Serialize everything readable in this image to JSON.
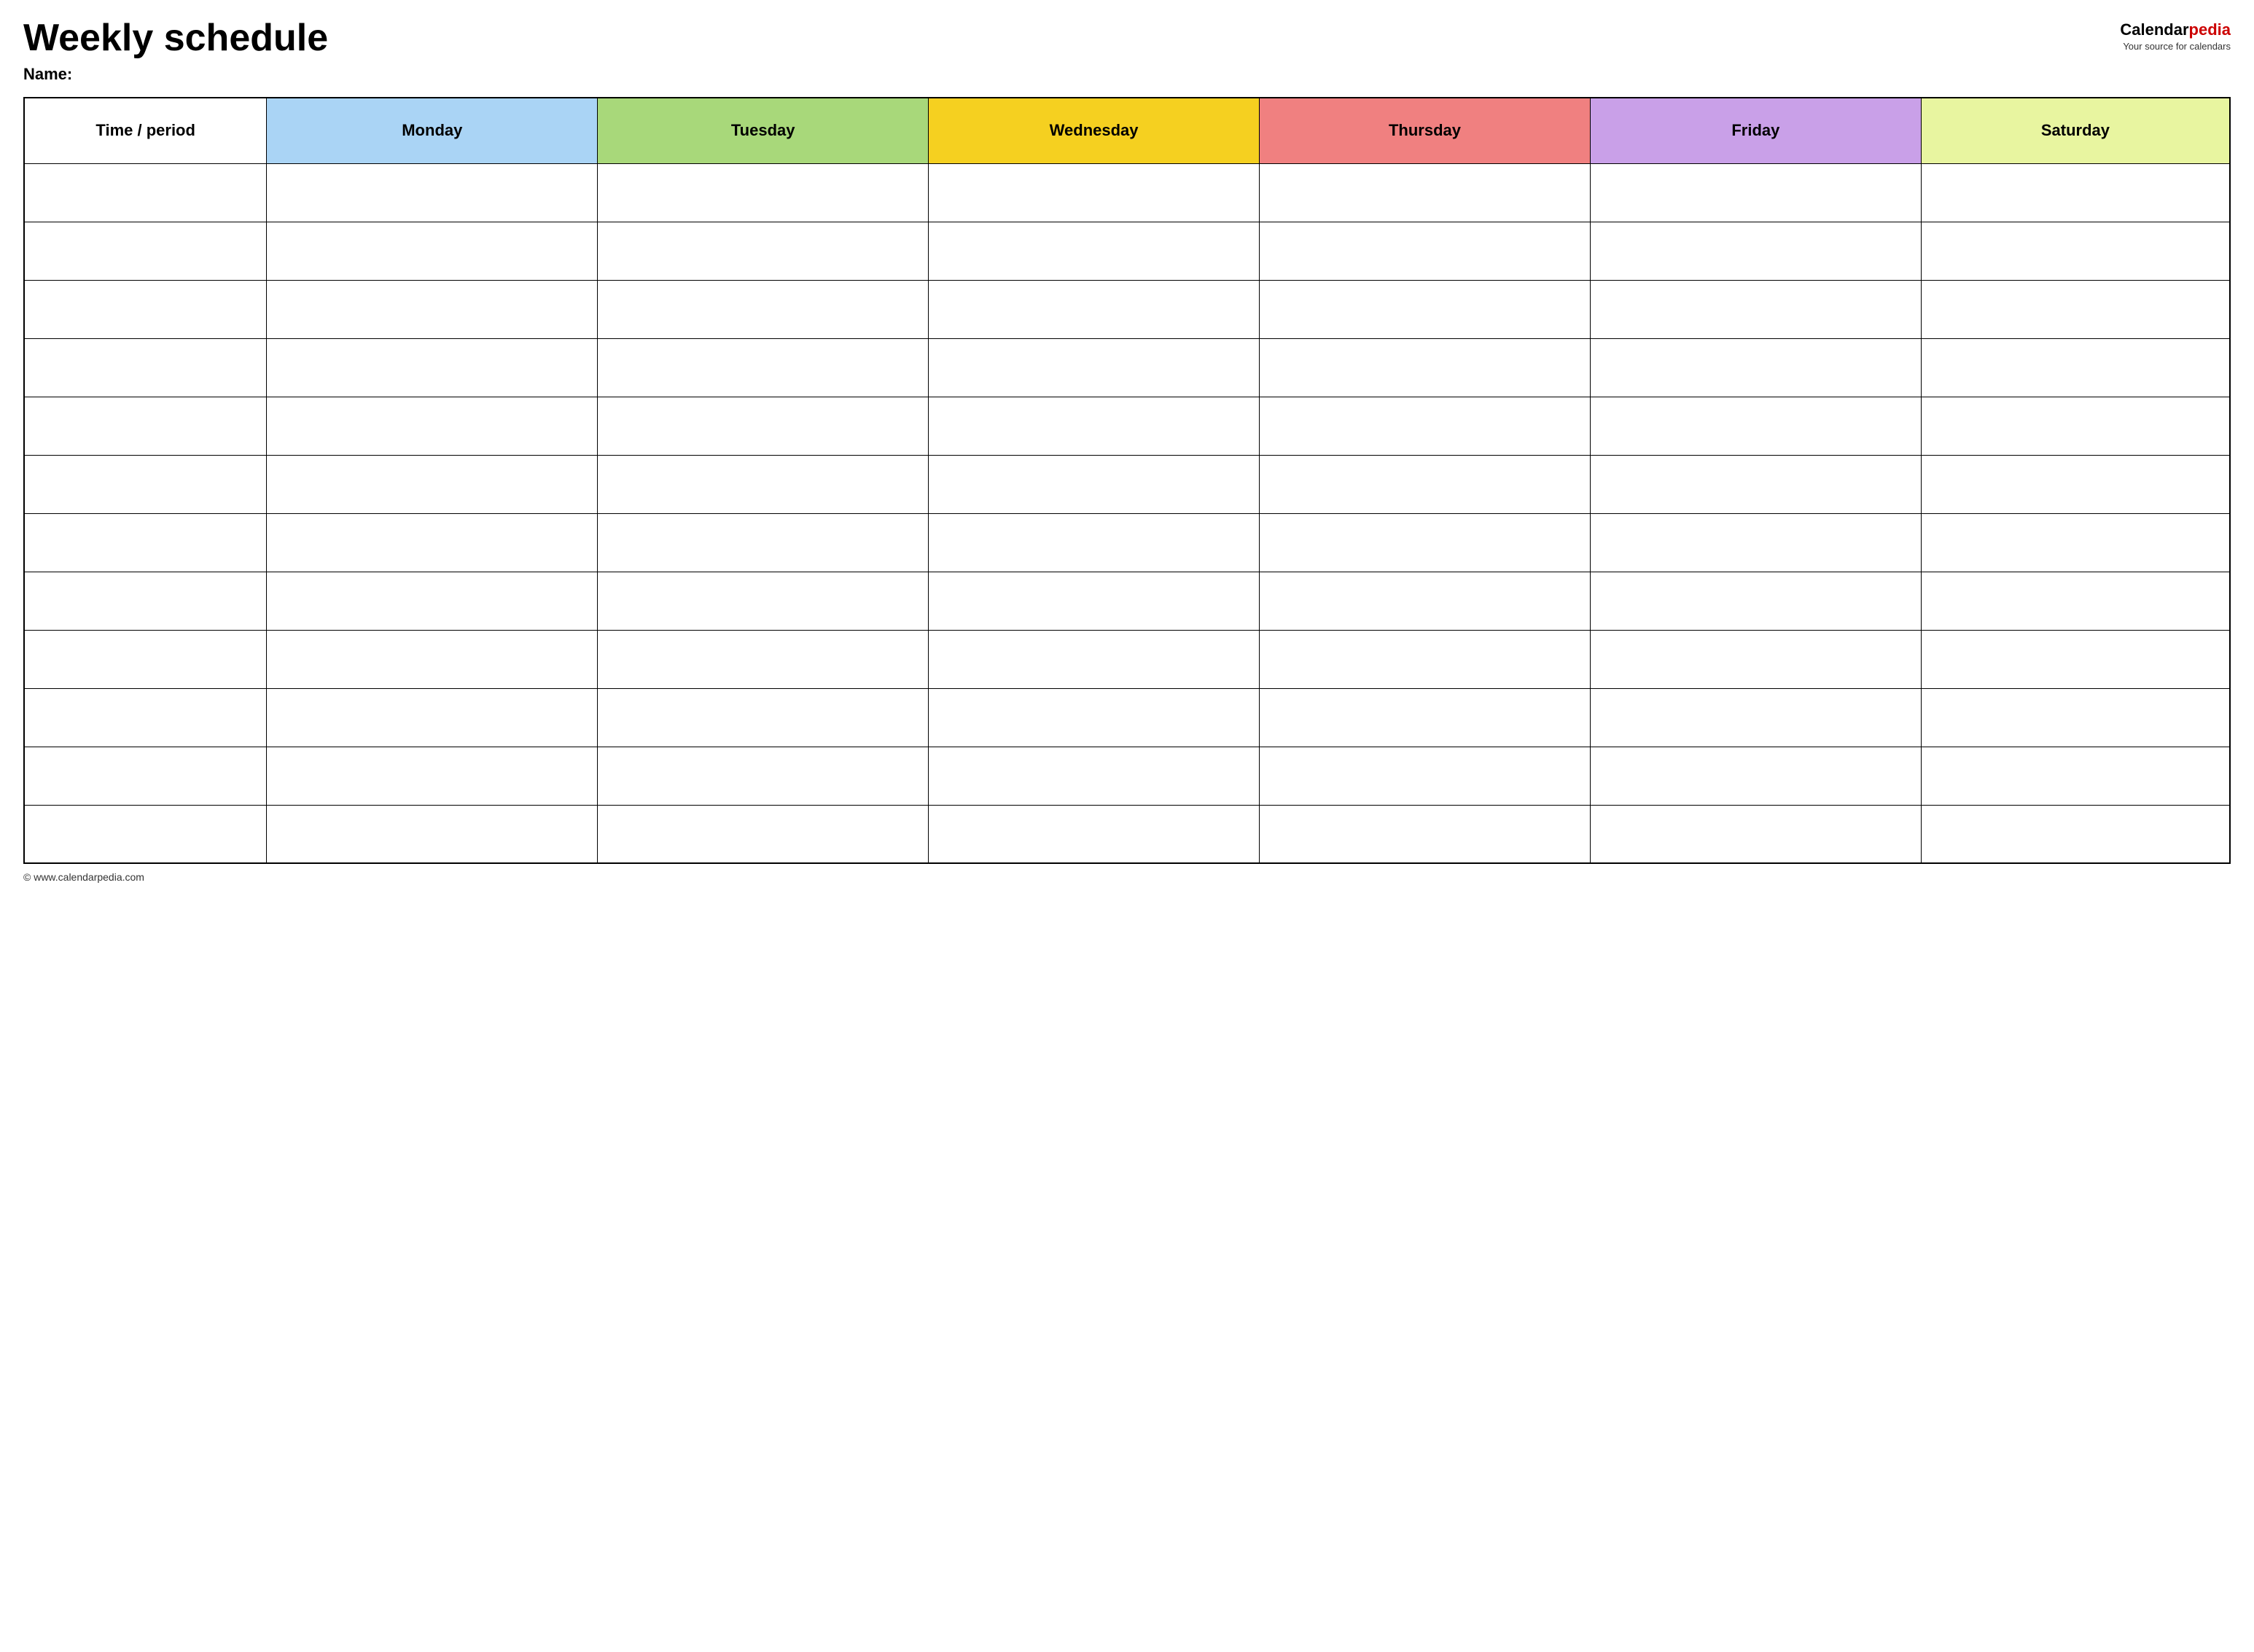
{
  "page": {
    "title": "Weekly schedule",
    "name_label": "Name:",
    "footer_url": "© www.calendarpedia.com"
  },
  "logo": {
    "calendar": "Calendar",
    "pedia": "pedia",
    "tagline": "Your source for calendars"
  },
  "table": {
    "headers": [
      {
        "id": "time",
        "label": "Time / period",
        "color_class": "col-time"
      },
      {
        "id": "monday",
        "label": "Monday",
        "color_class": "col-monday"
      },
      {
        "id": "tuesday",
        "label": "Tuesday",
        "color_class": "col-tuesday"
      },
      {
        "id": "wednesday",
        "label": "Wednesday",
        "color_class": "col-wednesday"
      },
      {
        "id": "thursday",
        "label": "Thursday",
        "color_class": "col-thursday"
      },
      {
        "id": "friday",
        "label": "Friday",
        "color_class": "col-friday"
      },
      {
        "id": "saturday",
        "label": "Saturday",
        "color_class": "col-saturday"
      }
    ],
    "row_count": 12
  }
}
